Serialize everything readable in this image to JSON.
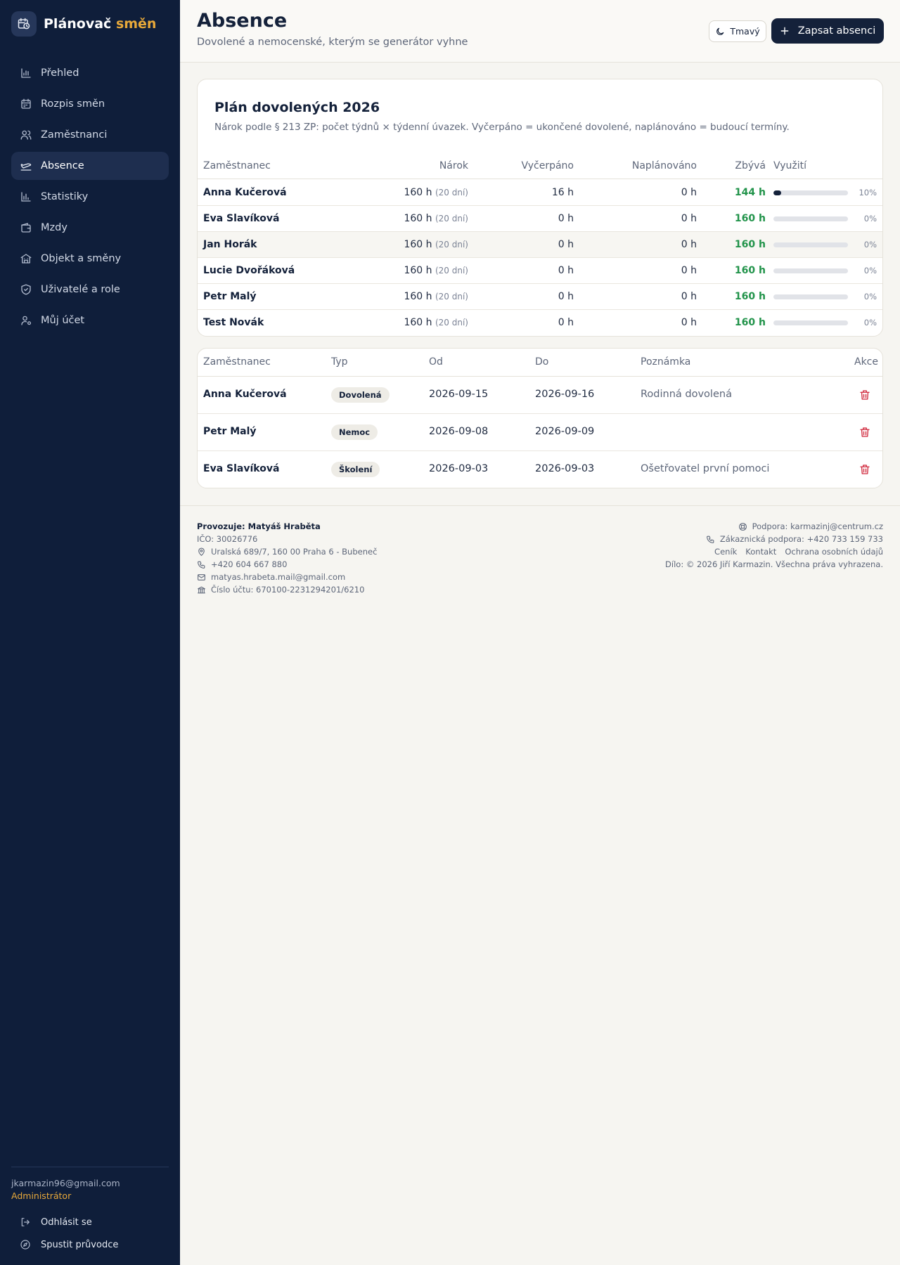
{
  "brand": {
    "name_main": "Plánovač",
    "name_accent": "směn"
  },
  "sidebar": {
    "items": [
      {
        "label": "Přehled",
        "icon": "bar-chart-icon"
      },
      {
        "label": "Rozpis směn",
        "icon": "calendar-icon"
      },
      {
        "label": "Zaměstnanci",
        "icon": "users-icon"
      },
      {
        "label": "Absence",
        "icon": "plane-icon",
        "active": true
      },
      {
        "label": "Statistiky",
        "icon": "stats-icon"
      },
      {
        "label": "Mzdy",
        "icon": "wallet-icon"
      },
      {
        "label": "Objekt a směny",
        "icon": "building-icon"
      },
      {
        "label": "Uživatelé a role",
        "icon": "shield-icon"
      },
      {
        "label": "Můj účet",
        "icon": "user-gear-icon"
      }
    ],
    "user_email": "jkarmazin96@gmail.com",
    "user_role": "Administrátor",
    "logout_label": "Odhlásit se",
    "guide_label": "Spustit průvodce"
  },
  "header": {
    "title": "Absence",
    "subtitle": "Dovolené a nemocenské, kterým se generátor vyhne",
    "theme_label": "Tmavý",
    "primary_label": "Zapsat absenci"
  },
  "vacation_plan": {
    "title": "Plán dovolených 2026",
    "description": "Nárok podle § 213 ZP: počet týdnů × týdenní úvazek. Vyčerpáno = ukončené dovolené, naplánováno = budoucí termíny.",
    "columns": {
      "employee": "Zaměstnanec",
      "entitlement": "Nárok",
      "used": "Vyčerpáno",
      "planned": "Naplánováno",
      "remaining": "Zbývá",
      "usage": "Využití"
    },
    "rows": [
      {
        "name": "Anna Kučerová",
        "entitlement": "160 h",
        "days": "(20 dní)",
        "used": "16 h",
        "planned": "0 h",
        "remaining": "144 h",
        "usage_pct": 10,
        "usage_label": "10%"
      },
      {
        "name": "Eva Slavíková",
        "entitlement": "160 h",
        "days": "(20 dní)",
        "used": "0 h",
        "planned": "0 h",
        "remaining": "160 h",
        "usage_pct": 0,
        "usage_label": "0%"
      },
      {
        "name": "Jan Horák",
        "entitlement": "160 h",
        "days": "(20 dní)",
        "used": "0 h",
        "planned": "0 h",
        "remaining": "160 h",
        "usage_pct": 0,
        "usage_label": "0%"
      },
      {
        "name": "Lucie Dvořáková",
        "entitlement": "160 h",
        "days": "(20 dní)",
        "used": "0 h",
        "planned": "0 h",
        "remaining": "160 h",
        "usage_pct": 0,
        "usage_label": "0%"
      },
      {
        "name": "Petr Malý",
        "entitlement": "160 h",
        "days": "(20 dní)",
        "used": "0 h",
        "planned": "0 h",
        "remaining": "160 h",
        "usage_pct": 0,
        "usage_label": "0%"
      },
      {
        "name": "Test Novák",
        "entitlement": "160 h",
        "days": "(20 dní)",
        "used": "0 h",
        "planned": "0 h",
        "remaining": "160 h",
        "usage_pct": 0,
        "usage_label": "0%"
      }
    ]
  },
  "absences": {
    "columns": {
      "employee": "Zaměstnanec",
      "type": "Typ",
      "from": "Od",
      "to": "Do",
      "note": "Poznámka",
      "actions": "Akce"
    },
    "rows": [
      {
        "name": "Anna Kučerová",
        "type": "Dovolená",
        "from": "2026-09-15",
        "to": "2026-09-16",
        "note": "Rodinná dovolená"
      },
      {
        "name": "Petr Malý",
        "type": "Nemoc",
        "from": "2026-09-08",
        "to": "2026-09-09",
        "note": ""
      },
      {
        "name": "Eva Slavíková",
        "type": "Školení",
        "from": "2026-09-03",
        "to": "2026-09-03",
        "note": "Ošetřovatel první pomoci"
      }
    ]
  },
  "footer": {
    "operator": "Provozuje: Matyáš Hraběta",
    "ico": "IČO: 30026776",
    "address": "Uralská 689/7, 160 00 Praha 6 - Bubeneč",
    "phone": "+420 604 667 880",
    "email": "matyas.hrabeta.mail@gmail.com",
    "account": "Číslo účtu: 670100-2231294201/6210",
    "support": "Podpora: karmazinj@centrum.cz",
    "customer_support": "Zákaznická podpora: +420 733 159 733",
    "links": [
      "Ceník",
      "Kontakt",
      "Ochrana osobních údajů"
    ],
    "copyright": "Dílo: © 2026 Jiří Karmazin. Všechna práva vyhrazena."
  },
  "colors": {
    "sidebar_bg": "#0f1e3a",
    "accent": "#e8a93a",
    "primary": "#14213a",
    "success": "#21934a",
    "danger": "#d0283c"
  }
}
